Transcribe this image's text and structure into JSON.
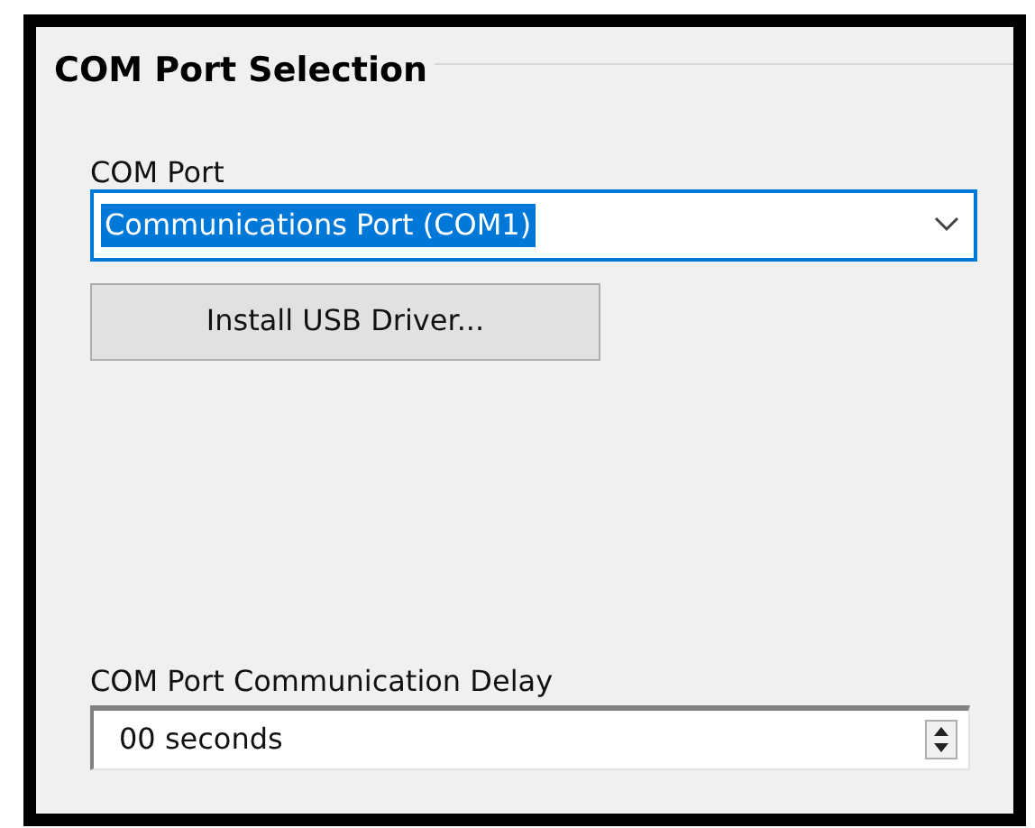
{
  "group": {
    "title": "COM Port Selection"
  },
  "com_port": {
    "label": "COM Port",
    "value": "Communications Port (COM1)",
    "text_selected": true
  },
  "install_button": {
    "label": "Install USB Driver..."
  },
  "delay": {
    "label": "COM Port Communication Delay",
    "value": "00 seconds"
  }
}
